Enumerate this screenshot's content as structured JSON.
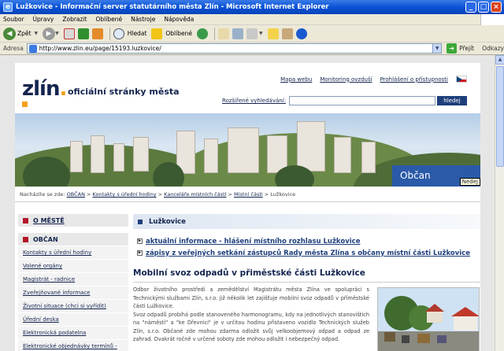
{
  "window": {
    "title": "Lužkovice - Informační server statutárního města Zlín - Microsoft Internet Explorer",
    "buttons": {
      "minimize": "_",
      "maximize": "□",
      "close": "×"
    }
  },
  "menu": [
    "Soubor",
    "Úpravy",
    "Zobrazit",
    "Oblíbené",
    "Nástroje",
    "Nápověda"
  ],
  "toolbar": {
    "back": "Zpět",
    "search": "Hledat",
    "favorites": "Oblíbené"
  },
  "address": {
    "label": "Adresa",
    "url": "http://www.zlin.eu/page/15193.luzkovice/",
    "go": "Přejít",
    "links": "Odkazy"
  },
  "header": {
    "logo": "zlín",
    "tagline": "oficiální stránky města",
    "links": [
      "Mapa webu",
      "Monitoring ovzduší",
      "Prohlášení o přístupnosti"
    ],
    "search_label": "Rozšířené vyhledávání:",
    "search_button": "hledej"
  },
  "banner": {
    "tab": "Občan",
    "tooltip": "Nedej"
  },
  "breadcrumb": {
    "prefix": "Nacházíte se zde:",
    "items": [
      "OBČAN",
      "Kontakty s úřední hodiny",
      "Kanceláře místních částí",
      "Místní části"
    ],
    "current": "Lužkovice",
    "sep": ">"
  },
  "nav": {
    "sections": [
      "O MĚSTĚ",
      "OBČAN"
    ],
    "items": [
      "Kontakty s úřední hodiny",
      "Volené orgány",
      "Magistrát - radnice",
      "Zveřejňované informace",
      "Životní situace (chci si vyřídit)",
      "Úřední deska",
      "Elektronická podatelna",
      "Elektronické objednávky termínů -"
    ]
  },
  "content": {
    "heading": "Lužkovice",
    "links": [
      "aktuální informace - hlášení místního rozhlasu Lužkovice",
      "zápisy z veřejných setkání zástupců Rady města Zlína s občany místní části Lužkovice"
    ],
    "article_title": "Mobilní svoz odpadů v přiměstské části Lužkovice",
    "paragraphs": [
      "Odbor životního prostředí a zemědělství Magistrátu města Zlína ve spolupráci s Technickými službami Zlín, s.r.o. již několik let zajišťuje mobilní svoz odpadů v příměstské části Lužkovice.",
      "Svoz odpadů probíhá podle stanoveného harmonogramu, kdy na jednotlivých stanovištích na \"náměstí\" a \"ke Dřevnici\" je v určitou hodinu přistaveno vozidlo Technických služeb Zlín, s.r.o. Občané zde mohou zdarma odložit svůj velkoobjemový odpad a odpad ze zahrad. Dvakrát ročně v určené soboty zde mohou odložit i nebezpečný odpad."
    ]
  }
}
